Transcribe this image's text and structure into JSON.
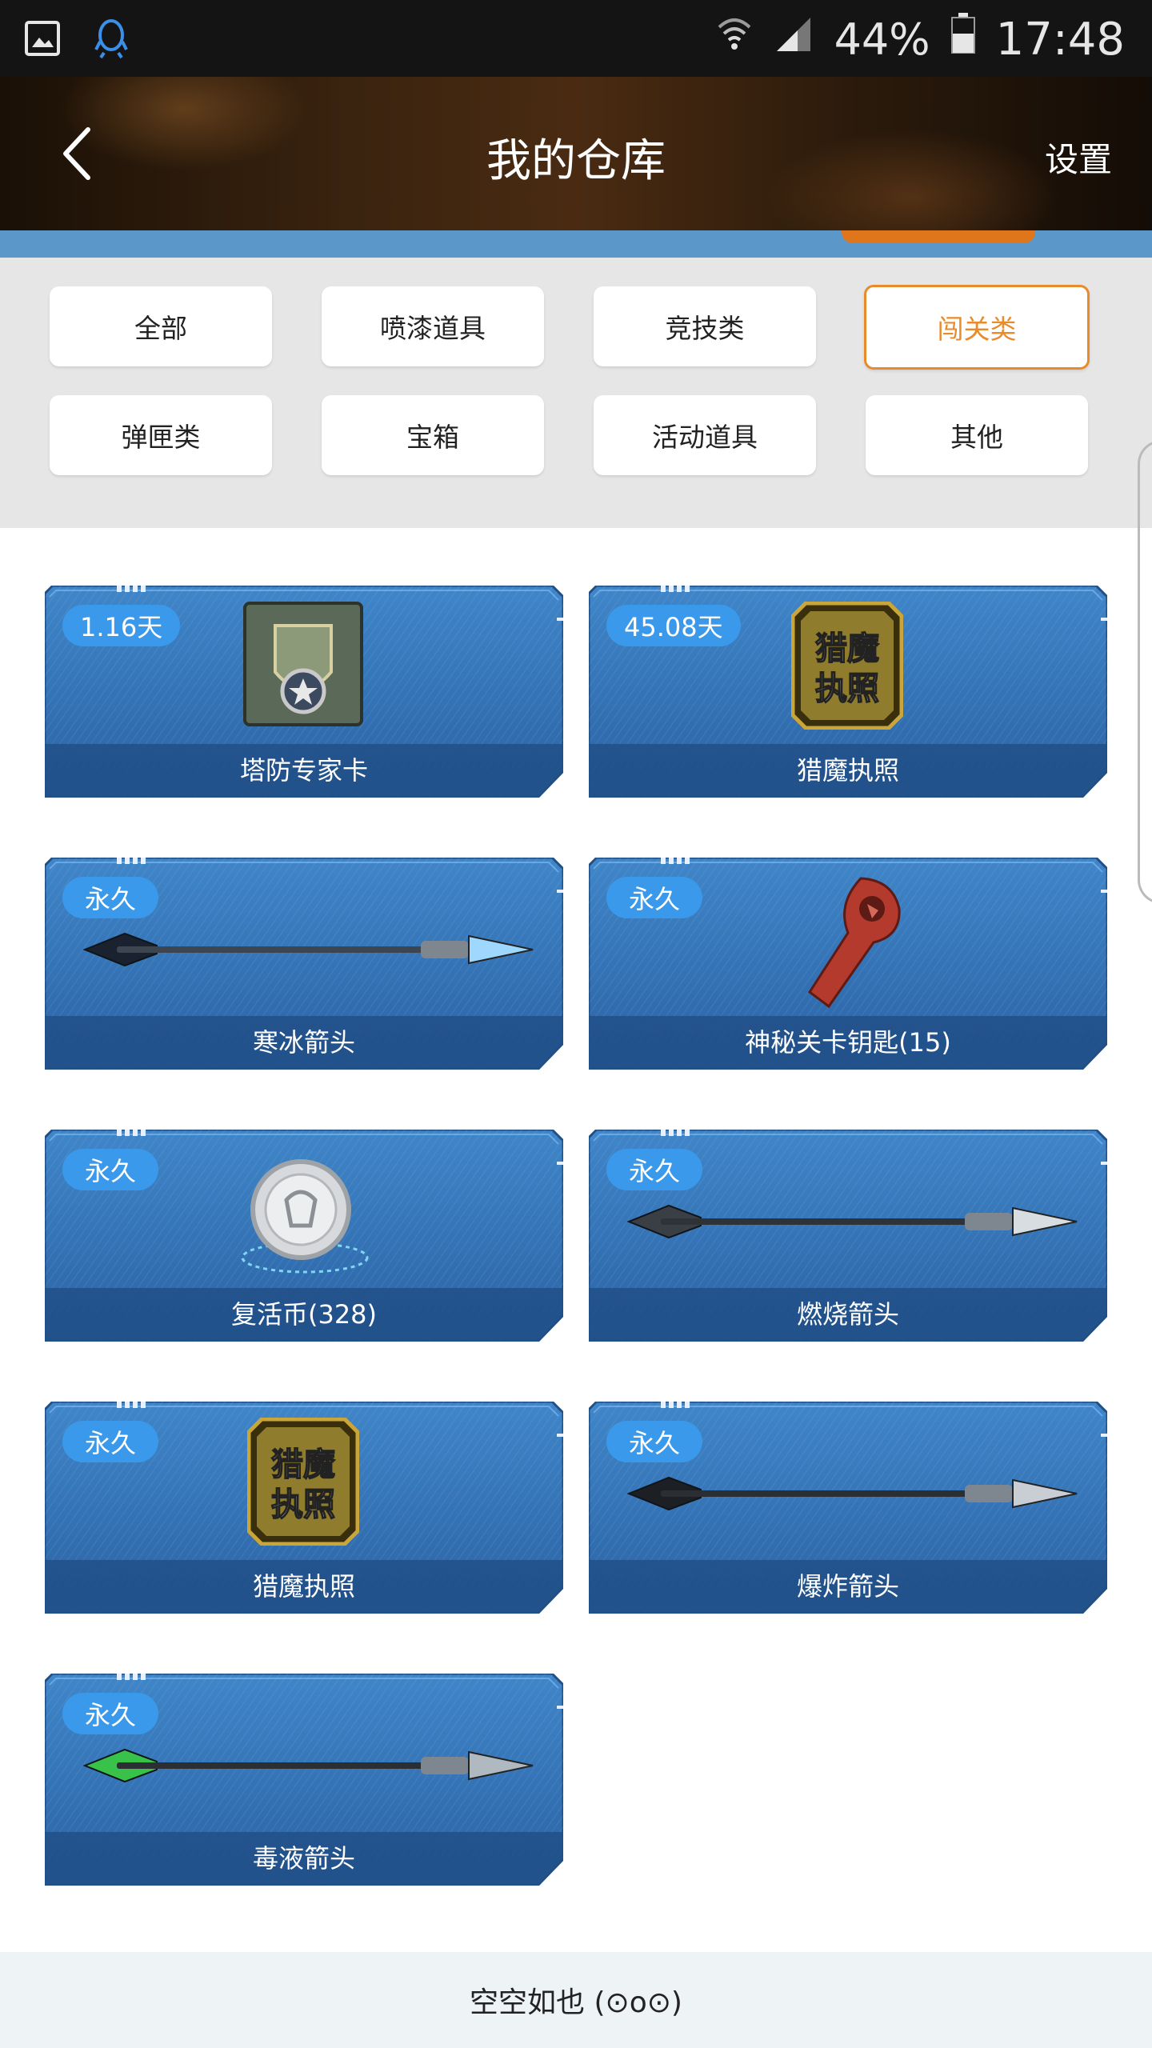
{
  "status_bar": {
    "battery_percent": "44%",
    "time": "17:48",
    "icons": [
      "gallery-icon",
      "qq-icon",
      "wifi-icon",
      "signal-icon",
      "battery-icon"
    ]
  },
  "header": {
    "title": "我的仓库",
    "settings_label": "设置"
  },
  "filters": [
    {
      "label": "全部",
      "active": false
    },
    {
      "label": "喷漆道具",
      "active": false
    },
    {
      "label": "竞技类",
      "active": false
    },
    {
      "label": "闯关类",
      "active": true
    },
    {
      "label": "弹匣类",
      "active": false
    },
    {
      "label": "宝箱",
      "active": false
    },
    {
      "label": "活动道具",
      "active": false
    },
    {
      "label": "其他",
      "active": false
    }
  ],
  "items": [
    {
      "badge": "1.16天",
      "name": "塔防专家卡",
      "icon": "shield-badge-icon"
    },
    {
      "badge": "45.08天",
      "name": "猎魔执照",
      "icon": "license-icon"
    },
    {
      "badge": "永久",
      "name": "寒冰箭头",
      "icon": "arrow-icon"
    },
    {
      "badge": "永久",
      "name": "神秘关卡钥匙(15)",
      "icon": "key-icon"
    },
    {
      "badge": "永久",
      "name": "复活币(328)",
      "icon": "coin-icon"
    },
    {
      "badge": "永久",
      "name": "燃烧箭头",
      "icon": "arrow-icon"
    },
    {
      "badge": "永久",
      "name": "猎魔执照",
      "icon": "license-icon"
    },
    {
      "badge": "永久",
      "name": "爆炸箭头",
      "icon": "arrow-icon"
    },
    {
      "badge": "永久",
      "name": "毒液箭头",
      "icon": "arrow-icon"
    }
  ],
  "license_icon_text": [
    "猎魔",
    "执照"
  ],
  "footer": {
    "text": "空空如也 (⊙o⊙)"
  },
  "colors": {
    "accent": "#e88b2a",
    "badge": "#3a99ea",
    "card": "#2f6db2",
    "header_strip": "#5b97c9"
  }
}
